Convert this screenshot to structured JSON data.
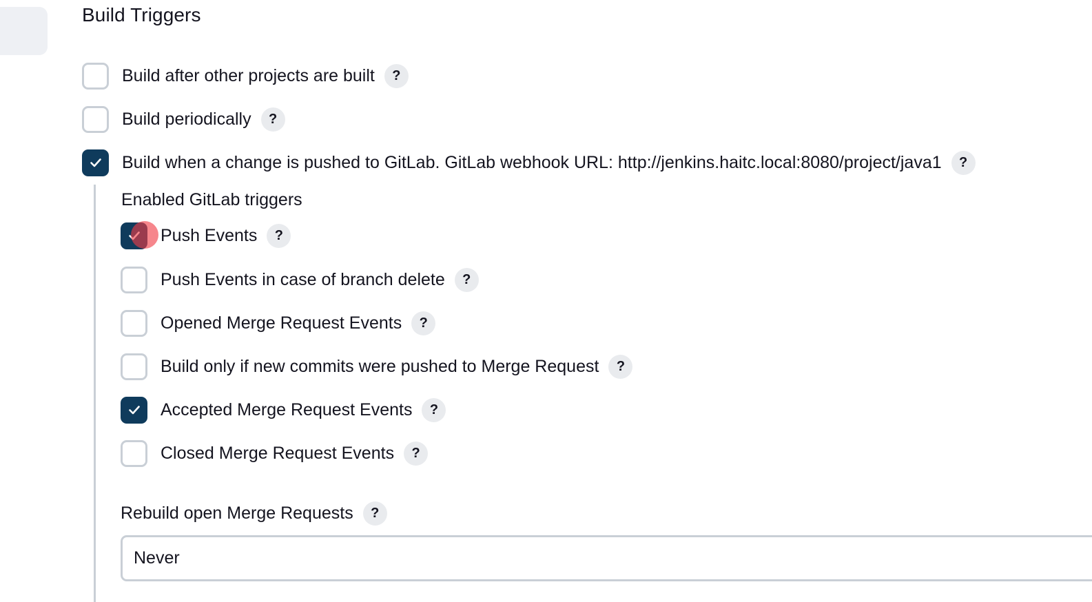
{
  "section": {
    "title": "Build Triggers"
  },
  "triggers": [
    {
      "label": "Build after other projects are built",
      "checked": false
    },
    {
      "label": "Build periodically",
      "checked": false
    },
    {
      "label": "Build when a change is pushed to GitLab. GitLab webhook URL: http://jenkins.haitc.local:8080/project/java1",
      "checked": true
    }
  ],
  "gitlab": {
    "heading": "Enabled GitLab triggers",
    "options": [
      {
        "label": "Push Events",
        "checked": true
      },
      {
        "label": "Push Events in case of branch delete",
        "checked": false
      },
      {
        "label": "Opened Merge Request Events",
        "checked": false
      },
      {
        "label": "Build only if new commits were pushed to Merge Request",
        "checked": false
      },
      {
        "label": "Accepted Merge Request Events",
        "checked": true
      },
      {
        "label": "Closed Merge Request Events",
        "checked": false
      }
    ],
    "rebuild": {
      "label": "Rebuild open Merge Requests",
      "selected": "Never"
    }
  },
  "help_glyph": "?",
  "colors": {
    "checked_fill": "#0f3b5c",
    "unchecked_border": "#c9cfd6",
    "help_bg": "#e9ebee",
    "click_marker": "#f03c46"
  }
}
